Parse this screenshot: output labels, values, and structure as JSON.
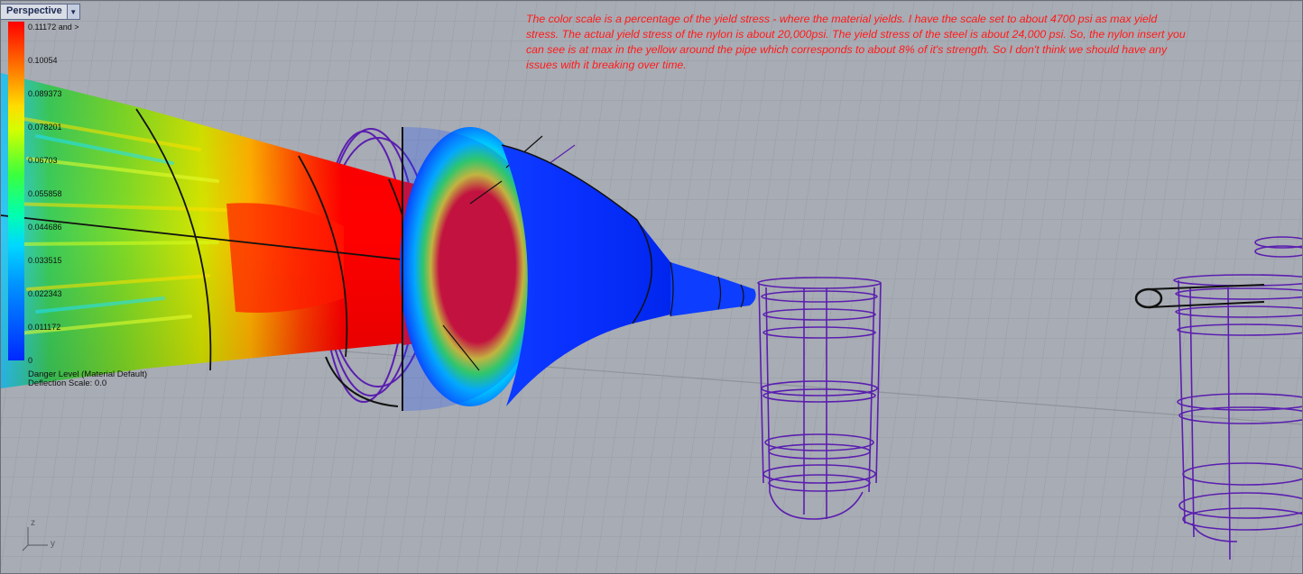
{
  "viewport": {
    "title": "Perspective"
  },
  "legend": {
    "title": "Danger Level (Material Default)",
    "deflection": "Deflection Scale: 0.0",
    "ticks": [
      "0.11172 and >",
      "0.10054",
      "0.089373",
      "0.078201",
      "0.06703",
      "0.055858",
      "0.044686",
      "0.033515",
      "0.022343",
      "0.011172",
      "0"
    ]
  },
  "annotation": {
    "text": "The color scale is a percentage of the yield stress - where the material yields.  I have the scale set to about 4700 psi as max yield stress.  The actual yield stress of the nylon is about 20,000psi.  The yield stress of the steel is about 24,000 psi.  So, the nylon insert you can see is at max in the yellow around the pipe which corresponds to about 8% of it's strength.  So I don't think we should have any issues with it breaking over time."
  },
  "axes": {
    "z": "z",
    "y": "y"
  },
  "colors": {
    "background": "#a8acb4",
    "grid": "#9a9ea6",
    "annotation": "#ff1a1a",
    "wireframe": "#5a1eb0"
  }
}
